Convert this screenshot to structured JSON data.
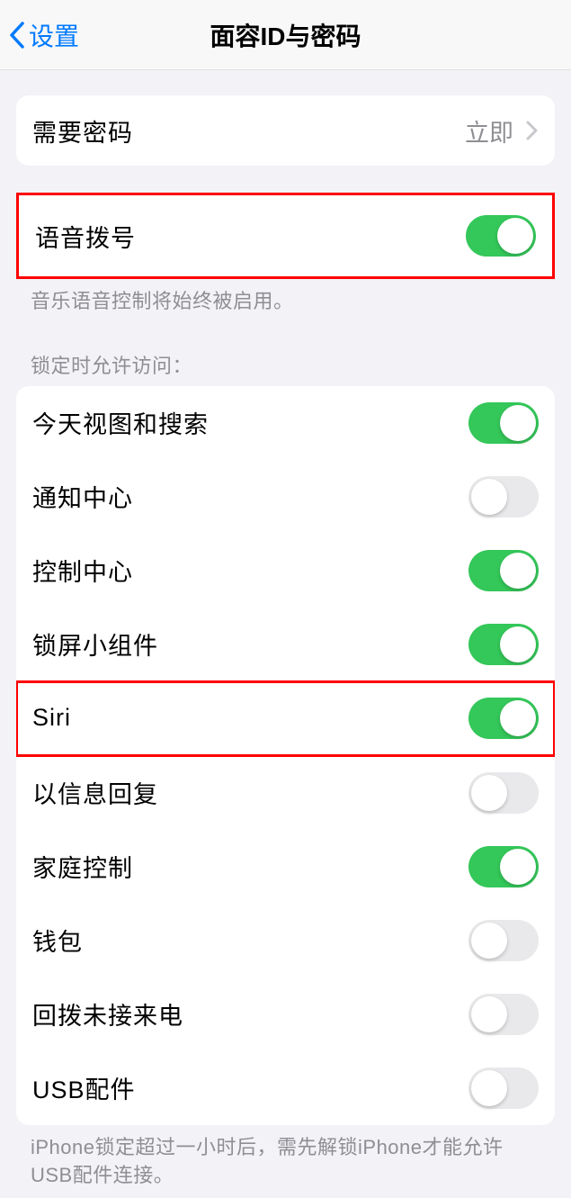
{
  "header": {
    "back_label": "设置",
    "title": "面容ID与密码"
  },
  "passcode_group": {
    "require_passcode_label": "需要密码",
    "require_passcode_value": "立即"
  },
  "voice_dial": {
    "label": "语音拨号",
    "enabled": true,
    "footer": "音乐语音控制将始终被启用。"
  },
  "lock_access": {
    "section_header": "锁定时允许访问：",
    "items": [
      {
        "label": "今天视图和搜索",
        "enabled": true
      },
      {
        "label": "通知中心",
        "enabled": false
      },
      {
        "label": "控制中心",
        "enabled": true
      },
      {
        "label": "锁屏小组件",
        "enabled": true
      },
      {
        "label": "Siri",
        "enabled": true,
        "highlighted": true
      },
      {
        "label": "以信息回复",
        "enabled": false
      },
      {
        "label": "家庭控制",
        "enabled": true
      },
      {
        "label": "钱包",
        "enabled": false
      },
      {
        "label": "回拨未接来电",
        "enabled": false
      },
      {
        "label": "USB配件",
        "enabled": false
      }
    ],
    "footer": "iPhone锁定超过一小时后，需先解锁iPhone才能允许USB配件连接。"
  }
}
